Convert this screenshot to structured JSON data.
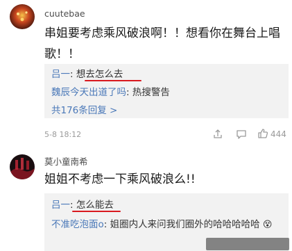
{
  "comment1": {
    "username": "cuutebae",
    "text": "串姐要考虑乘风破浪啊！！想看你在舞台上唱歌！！",
    "replies": [
      {
        "author": "吕一",
        "sep": ": ",
        "text": "想去怎么去"
      },
      {
        "author": "魏辰今天出道了吗",
        "sep": ": ",
        "text": "热搜警告"
      }
    ],
    "more_replies": "共176条回复 >",
    "time": "5-8 18:12",
    "like_count": "444"
  },
  "comment2": {
    "username": "莫小童南希",
    "text": "姐姐不考虑一下乘风破浪么!!",
    "replies": [
      {
        "author": "吕一",
        "sep": ": ",
        "text": "怎么能去"
      },
      {
        "author": "不准吃泡面o",
        "sep": ": ",
        "text": "姐圈内人来问我们圈外的哈哈哈哈哈"
      }
    ],
    "emoji": "😵"
  },
  "icons": {
    "share": "share-icon",
    "comment": "comment-icon",
    "like": "like-icon"
  },
  "colors": {
    "link_blue": "#4a78b8",
    "underline_red": "#d9191f",
    "reply_bg": "#f2f2f2"
  }
}
